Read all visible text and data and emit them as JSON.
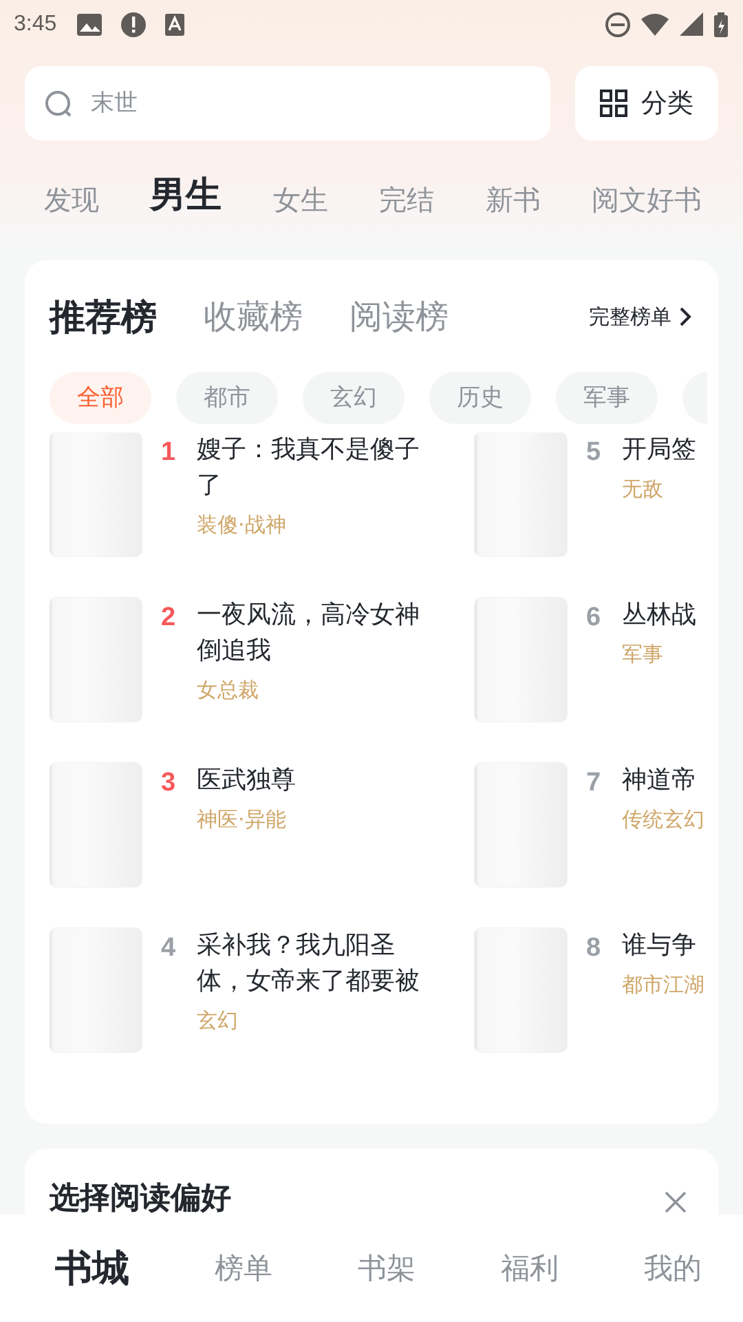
{
  "status_bar": {
    "time": "3:45"
  },
  "search": {
    "placeholder": "末世"
  },
  "category_button": {
    "label": "分类"
  },
  "channels": [
    {
      "label": "发现",
      "selected": false
    },
    {
      "label": "男生",
      "selected": true
    },
    {
      "label": "女生",
      "selected": false
    },
    {
      "label": "完结",
      "selected": false
    },
    {
      "label": "新书",
      "selected": false
    },
    {
      "label": "阅文好书",
      "selected": false
    }
  ],
  "ranking": {
    "tabs": [
      {
        "label": "推荐榜",
        "selected": true
      },
      {
        "label": "收藏榜",
        "selected": false
      },
      {
        "label": "阅读榜",
        "selected": false
      }
    ],
    "full_list_link": "完整榜单",
    "filters": [
      {
        "label": "全部",
        "selected": true
      },
      {
        "label": "都市",
        "selected": false
      },
      {
        "label": "玄幻",
        "selected": false
      },
      {
        "label": "历史",
        "selected": false
      },
      {
        "label": "军事",
        "selected": false
      }
    ],
    "books": [
      {
        "rank": "1",
        "top": true,
        "title": "嫂子：我真不是傻子了",
        "tags": "装傻·战神"
      },
      {
        "rank": "2",
        "top": true,
        "title": "一夜风流，高冷女神倒追我",
        "tags": "女总裁"
      },
      {
        "rank": "3",
        "top": true,
        "title": "医武独尊",
        "tags": "神医·异能"
      },
      {
        "rank": "4",
        "top": false,
        "title": "采补我？我九阳圣体，女帝来了都要被",
        "tags": "玄幻"
      },
      {
        "rank": "5",
        "top": false,
        "title": "开局签",
        "tags": "无敌"
      },
      {
        "rank": "6",
        "top": false,
        "title": "丛林战",
        "tags": "军事"
      },
      {
        "rank": "7",
        "top": false,
        "title": "神道帝",
        "tags": "传统玄幻"
      },
      {
        "rank": "8",
        "top": false,
        "title": "谁与争",
        "tags": "都市江湖"
      }
    ]
  },
  "preference_card": {
    "title": "选择阅读偏好"
  },
  "bottom_nav": [
    {
      "label": "书城",
      "selected": true
    },
    {
      "label": "榜单",
      "selected": false
    },
    {
      "label": "书架",
      "selected": false
    },
    {
      "label": "福利",
      "selected": false
    },
    {
      "label": "我的",
      "selected": false
    }
  ]
}
